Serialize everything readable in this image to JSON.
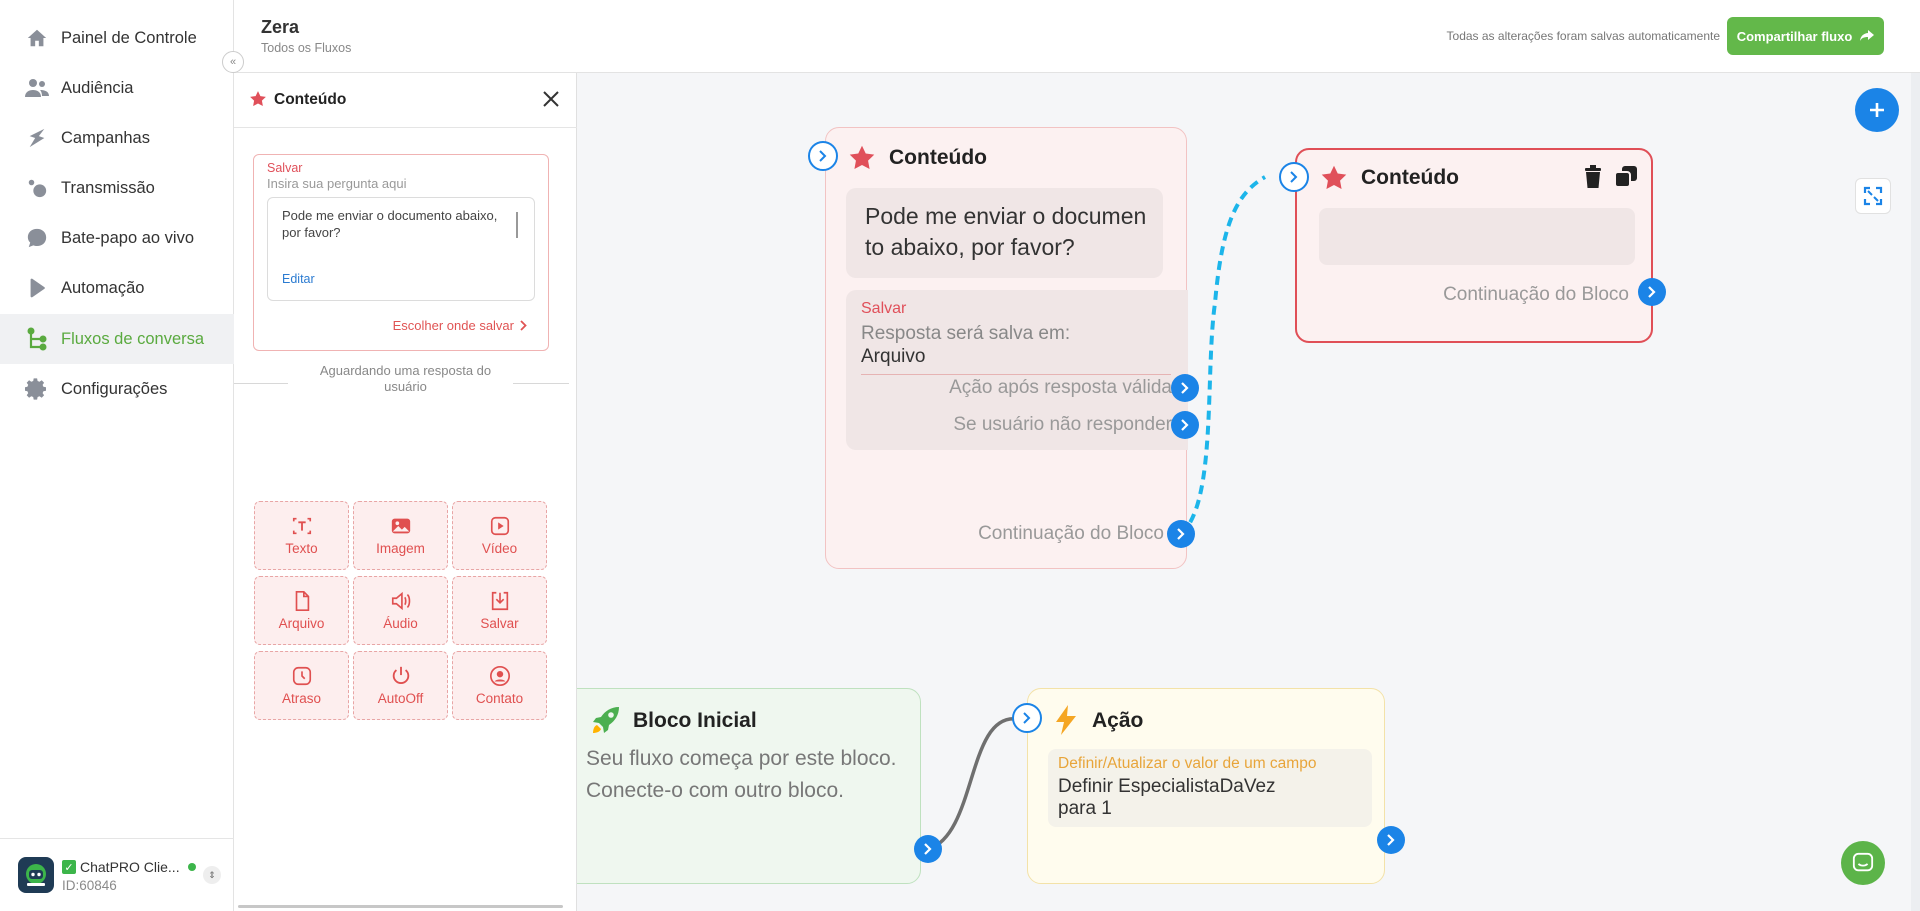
{
  "sidebar": {
    "items": [
      {
        "label": "Painel de Controle",
        "icon": "home-icon"
      },
      {
        "label": "Audiência",
        "icon": "users-icon"
      },
      {
        "label": "Campanhas",
        "icon": "campaign-icon"
      },
      {
        "label": "Transmissão",
        "icon": "broadcast-icon"
      },
      {
        "label": "Bate-papo ao vivo",
        "icon": "chat-bubble-icon"
      },
      {
        "label": "Automação",
        "icon": "play-icon"
      },
      {
        "label": "Fluxos de conversa",
        "icon": "flow-icon",
        "active": true
      },
      {
        "label": "Configurações",
        "icon": "gear-icon"
      }
    ],
    "account": {
      "name": "ChatPRO Clie...",
      "id": "ID:60846"
    }
  },
  "header": {
    "title": "Zera",
    "subtitle": "Todos os Fluxos",
    "autosave": "Todas as alterações foram salvas automaticamente",
    "share_label": "Compartilhar fluxo"
  },
  "panel": {
    "title": "Conteúdo",
    "question": {
      "save_label": "Salvar",
      "placeholder": "Insira sua pergunta aqui",
      "text": "Pode me enviar o documento abaixo, por favor?",
      "edit_label": "Editar",
      "choose_label": "Escolher onde salvar"
    },
    "waiting": "Aguardando uma resposta do usuário",
    "tools": [
      {
        "label": "Texto",
        "icon": "text-icon"
      },
      {
        "label": "Imagem",
        "icon": "image-icon"
      },
      {
        "label": "Vídeo",
        "icon": "video-icon"
      },
      {
        "label": "Arquivo",
        "icon": "file-icon"
      },
      {
        "label": "Áudio",
        "icon": "audio-icon"
      },
      {
        "label": "Salvar",
        "icon": "save-icon"
      },
      {
        "label": "Atraso",
        "icon": "clock-icon"
      },
      {
        "label": "AutoOff",
        "icon": "power-icon"
      },
      {
        "label": "Contato",
        "icon": "contact-icon"
      }
    ]
  },
  "canvas": {
    "node_content_main": {
      "title": "Conteúdo",
      "message": "Pode me enviar o documen to abaixo, por favor?",
      "save_label": "Salvar",
      "save_info": "Resposta será salva em:",
      "save_target": "Arquivo",
      "valid_action": "Ação após resposta válida",
      "no_response": "Se usuário não responder",
      "continuation": "Continuação do Bloco"
    },
    "node_content_second": {
      "title": "Conteúdo",
      "continuation": "Continuação do Bloco"
    },
    "node_start": {
      "title": "Bloco Inicial",
      "text": "Seu fluxo começa por este bloco. Conecte-o com outro bloco."
    },
    "node_action": {
      "title": "Ação",
      "action_label": "Definir/Atualizar o valor de um campo",
      "action_value_line1": "Definir EspecialistaDaVez",
      "action_value_line2": "para 1"
    }
  },
  "colors": {
    "accent_green": "#63b84a",
    "brand_blue": "#1b84e7",
    "content_red": "#e05050",
    "action_orange": "#e8a53a"
  }
}
